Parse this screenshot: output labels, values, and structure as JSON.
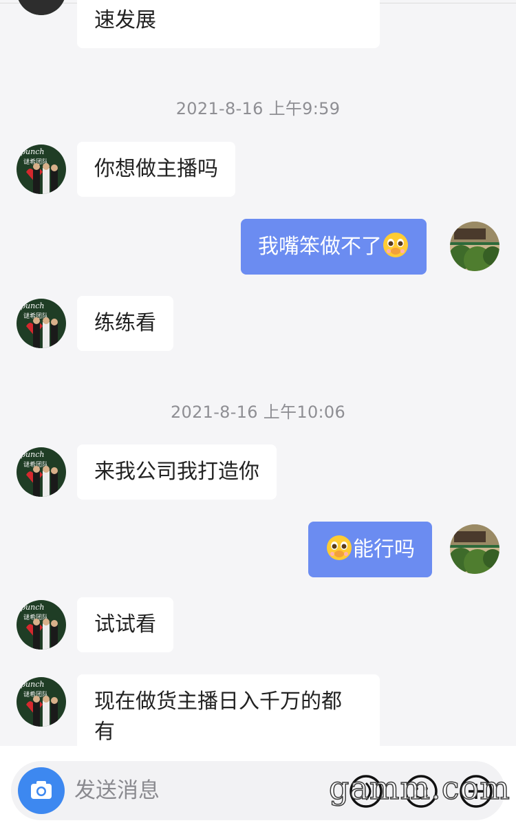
{
  "chat": {
    "messages": [
      {
        "side": "left",
        "text": "速发展"
      },
      {
        "type": "time",
        "text": "2021-8-16 上午9:59"
      },
      {
        "side": "left",
        "text": "你想做主播吗"
      },
      {
        "side": "right",
        "text": "我嘴笨做不了",
        "emoji": "pleading-face"
      },
      {
        "side": "left",
        "text": "练练看"
      },
      {
        "type": "time",
        "text": "2021-8-16 上午10:06"
      },
      {
        "side": "left",
        "text": "来我公司我打造你"
      },
      {
        "side": "right",
        "text": "能行吗",
        "emoji": "pleading-face"
      },
      {
        "side": "left",
        "text": "试试看"
      },
      {
        "side": "left",
        "text": "现在做货主播日入千万的都有"
      }
    ],
    "timestamps": [
      "2021-8-16 上午9:59",
      "2021-8-16 上午10:06"
    ],
    "m0": "速发展",
    "m1": "你想做主播吗",
    "m2": "我嘴笨做不了",
    "m3": "练练看",
    "m4": "来我公司我打造你",
    "m5": "能行吗",
    "m6": "试试看",
    "m7a": "现在做货主播日入千万的都",
    "m7b": "有"
  },
  "composer": {
    "placeholder": "发送消息",
    "icons": [
      "camera-icon",
      "voice-icon",
      "emoji-icon",
      "plus-icon"
    ]
  },
  "watermark": "gamm.com",
  "colors": {
    "background": "#f5f5f7",
    "bubble_left": "#ffffff",
    "bubble_right": "#6b8cf1",
    "camera": "#3d88f0",
    "timestamp": "#8e8e93"
  }
}
